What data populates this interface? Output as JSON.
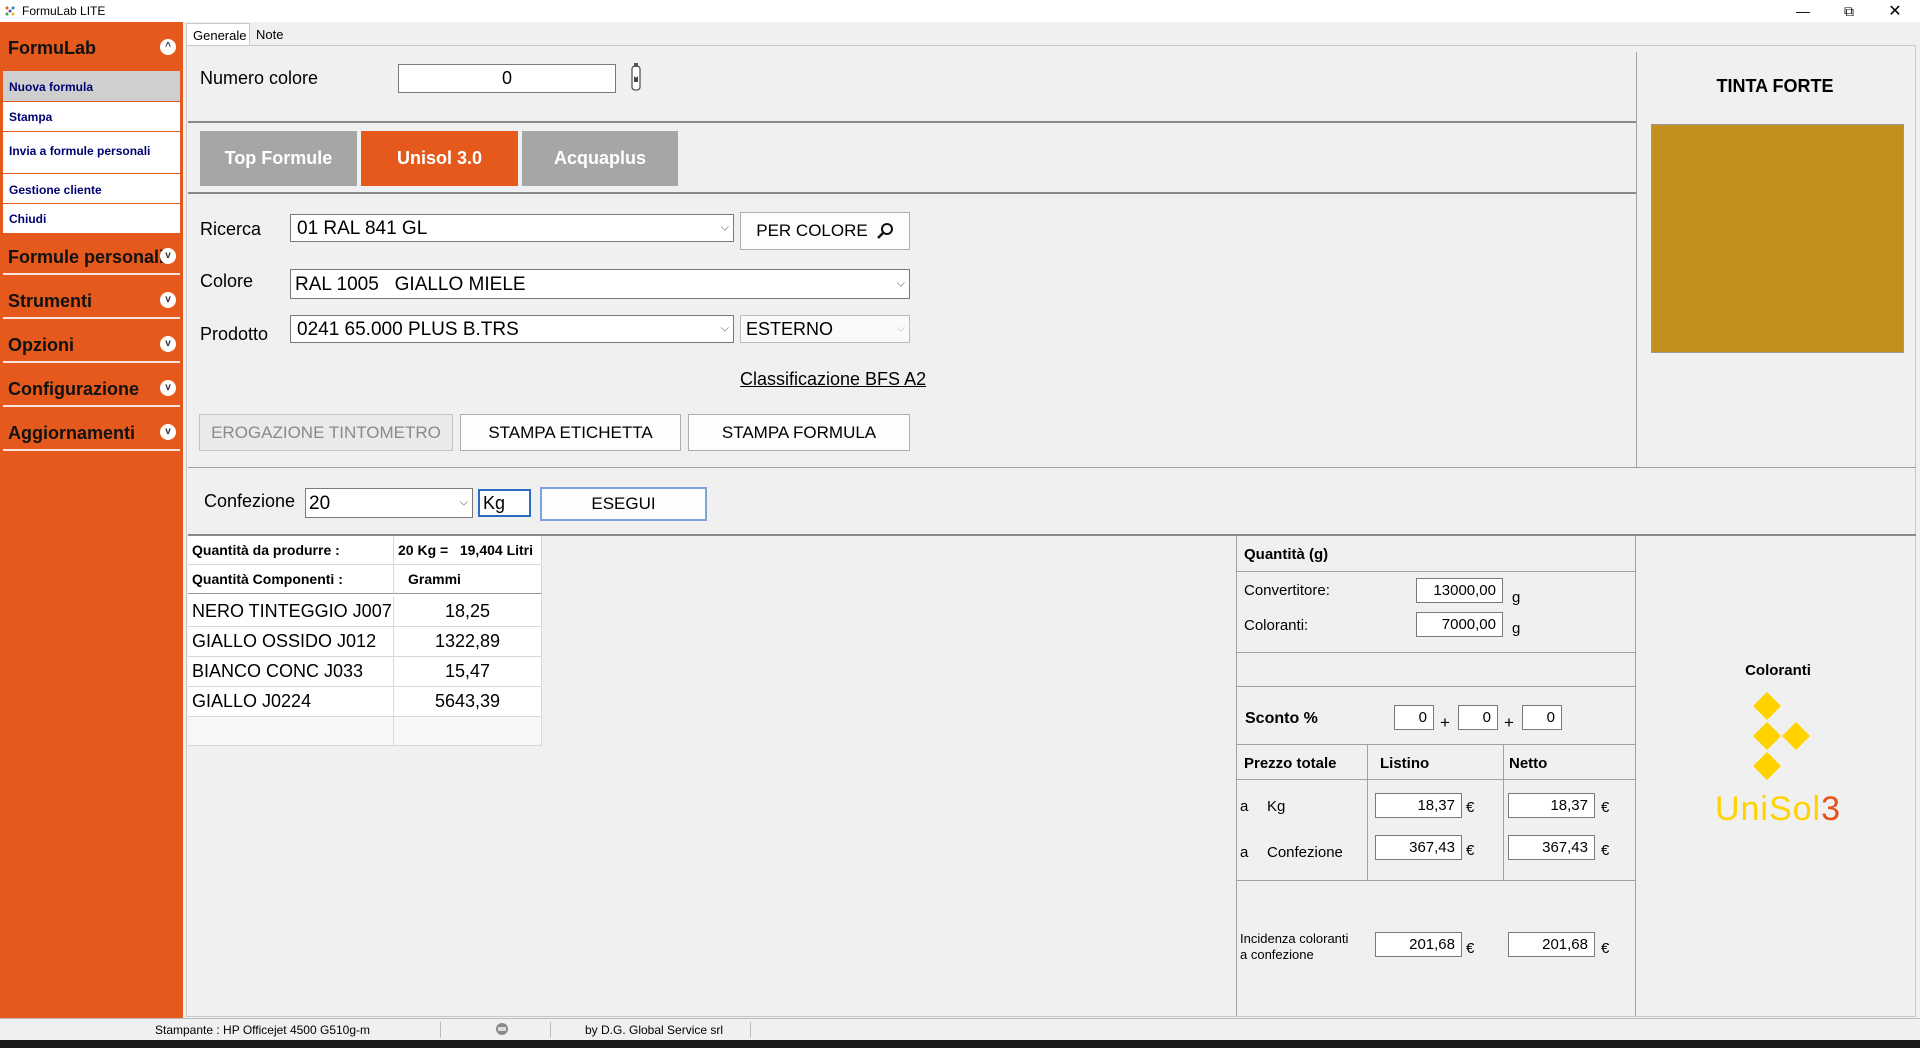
{
  "window": {
    "title": "FormuLab LITE"
  },
  "sidebar": {
    "sections": [
      {
        "label": "FormuLab",
        "expanded": true
      },
      {
        "label": "Formule personali"
      },
      {
        "label": "Strumenti"
      },
      {
        "label": "Opzioni"
      },
      {
        "label": "Configurazione"
      },
      {
        "label": "Aggiornamenti"
      }
    ],
    "items": [
      "Nuova formula",
      "Stampa",
      "Invia a formule personali",
      "Gestione cliente",
      "Chiudi"
    ]
  },
  "tabs": [
    "Generale",
    "Note"
  ],
  "header": {
    "numero_colore_label": "Numero colore",
    "numero_colore_value": "0"
  },
  "catalog_tabs": [
    "Top Formule",
    "Unisol 3.0",
    "Acquaplus"
  ],
  "form": {
    "ricerca_label": "Ricerca",
    "ricerca_value": "01 RAL 841 GL",
    "per_colore_label": "PER COLORE",
    "colore_label": "Colore",
    "colore_value": "RAL 1005   GIALLO MIELE",
    "prodotto_label": "Prodotto",
    "prodotto_value": "0241 65.000 PLUS B.TRS",
    "uso_value": "ESTERNO",
    "classificazione": "Classificazione BFS A2",
    "btn_erogazione": "EROGAZIONE TINTOMETRO",
    "btn_etichetta": "STAMPA ETICHETTA",
    "btn_formula": "STAMPA FORMULA"
  },
  "preview": {
    "title": "TINTA FORTE",
    "swatch_color": "#c2901f"
  },
  "confezione": {
    "label": "Confezione",
    "value": "20",
    "unit": "Kg",
    "esegui_label": "ESEGUI"
  },
  "grid": {
    "quantita_label": "Quantità da produrre :",
    "quantita_value": "20 Kg =   19,404 Litri",
    "componenti_label": "Quantità Componenti :",
    "grammi_label": "Grammi",
    "rows": [
      {
        "name": "NERO TINTEGGIO J007",
        "value": "18,25"
      },
      {
        "name": "GIALLO OSSIDO J012",
        "value": "1322,89"
      },
      {
        "name": "BIANCO CONC J033",
        "value": "15,47"
      },
      {
        "name": "GIALLO J0224",
        "value": "5643,39"
      }
    ]
  },
  "quantities": {
    "title": "Quantità (g)",
    "convertitore_label": "Convertitore:",
    "convertitore_value": "13000,00",
    "coloranti_label": "Coloranti:",
    "coloranti_value": "7000,00",
    "unit_g": "g",
    "sconto_label": "Sconto %",
    "sconto_values": [
      "0",
      "0",
      "0"
    ],
    "plus": "+",
    "prezzo_totale_label": "Prezzo totale",
    "listino_label": "Listino",
    "netto_label": "Netto",
    "a": "a",
    "kg_label": "Kg",
    "confezione_label": "Confezione",
    "listino_kg": "18,37",
    "netto_kg": "18,37",
    "listino_conf": "367,43",
    "netto_conf": "367,43",
    "incidenza_label_1": "Incidenza coloranti",
    "incidenza_label_2": "a confezione",
    "incidenza_listino": "201,68",
    "incidenza_netto": "201,68",
    "euro": "€"
  },
  "brand": {
    "coloranti_label": "Coloranti",
    "logo_text_main": "UniSol",
    "logo_text_num": "3",
    "logo_yellow": "#ffd200",
    "logo_orange": "#e8501a"
  },
  "status": {
    "printer": "Stampante : HP Officejet 4500 G510g-m",
    "credits": "by D.G. Global Service srl"
  },
  "colors": {
    "accent_orange": "#e55a1c",
    "tab_gray": "#a6a6a6"
  }
}
